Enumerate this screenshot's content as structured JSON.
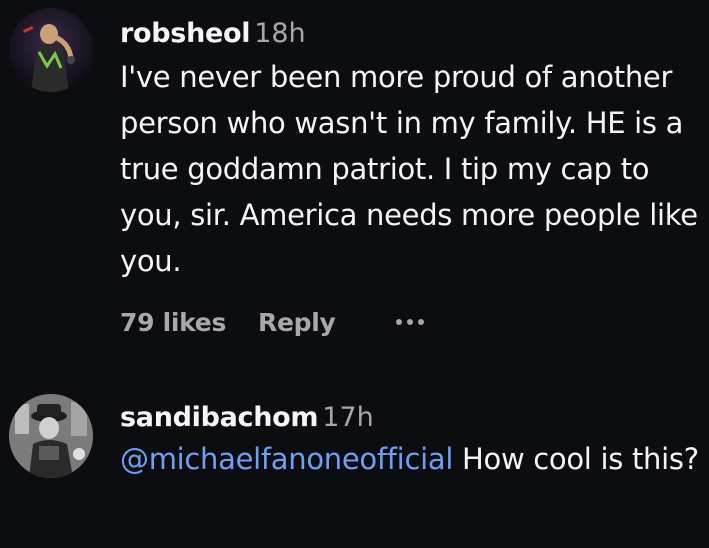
{
  "comments": [
    {
      "username": "robsheol",
      "timestamp": "18h",
      "text": "I've never been more proud of another person who wasn't in my family. HE is a true goddamn patriot. I tip my cap to you, sir. America needs more people like you.",
      "likes_label": "79 likes",
      "reply_label": "Reply",
      "more_icon": "ellipsis-icon"
    },
    {
      "username": "sandibachom",
      "timestamp": "17h",
      "mention": "@michaelfanoneofficial",
      "text": " How cool is this?"
    }
  ],
  "colors": {
    "background": "#0c0d11",
    "text": "#f5f5f5",
    "secondary": "#a8a8a8",
    "mention": "#6f9ff2"
  }
}
